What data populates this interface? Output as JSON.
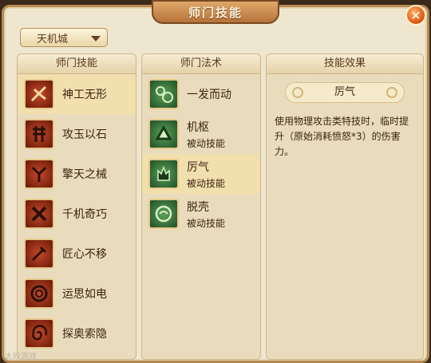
{
  "title": "师门技能",
  "close_icon": "close-icon",
  "dropdown": {
    "selected": "天机城"
  },
  "columns": {
    "skills_header": "师门技能",
    "spells_header": "师门法术",
    "effect_header": "技能效果"
  },
  "skills": [
    {
      "label": "神工无形",
      "icon": "red"
    },
    {
      "label": "攻玉以石",
      "icon": "red"
    },
    {
      "label": "擎天之械",
      "icon": "red"
    },
    {
      "label": "千机奇巧",
      "icon": "red"
    },
    {
      "label": "匠心不移",
      "icon": "red"
    },
    {
      "label": "运思如电",
      "icon": "red"
    },
    {
      "label": "探奥索隐",
      "icon": "red"
    }
  ],
  "spells": [
    {
      "name": "一发而动",
      "type": ""
    },
    {
      "name": "机枢",
      "type": "被动技能"
    },
    {
      "name": "厉气",
      "type": "被动技能"
    },
    {
      "name": "脱壳",
      "type": "被动技能"
    }
  ],
  "effect": {
    "name": "厉气",
    "description": "使用物理攻击类特技时，临时提升（原始消耗愤怒*3）的伤害力。"
  },
  "watermark": "大皎游戏"
}
